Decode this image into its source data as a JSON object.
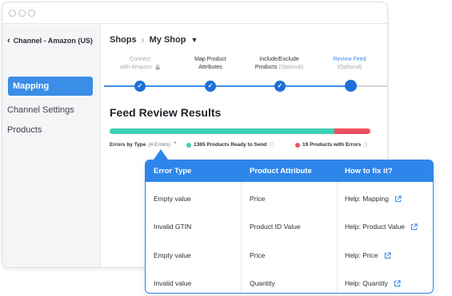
{
  "sidebar": {
    "back_label": "Channel - Amazon (US)",
    "items": [
      {
        "label": "Mapping",
        "active": true
      },
      {
        "label": "Channel Settings",
        "active": false
      },
      {
        "label": "Products",
        "active": false
      }
    ]
  },
  "breadcrumb": {
    "root": "Shops",
    "current": "My Shop"
  },
  "steps": [
    {
      "line1": "Connect",
      "line2": "with Amazon",
      "state": "disabled"
    },
    {
      "line1": "Map Product",
      "line2": "Attributes",
      "state": "done"
    },
    {
      "line1": "Include/Exclude",
      "line2": "Products",
      "optional": "(Optional)",
      "state": "done"
    },
    {
      "line1": "Review Feed",
      "line2": "(Optional)",
      "state": "current"
    }
  ],
  "results": {
    "title": "Feed Review Results",
    "ready_fraction": 0.8626,
    "errors_by_type_label": "Errors by Type",
    "errors_by_type_count": "(4 Errors)",
    "ready_label": "1365 Products Ready to Send",
    "errors_label": "19 Products with Errors"
  },
  "colors": {
    "primary": "#2f86ea",
    "ready": "#3fd0b4",
    "error": "#f04f5f"
  },
  "table": {
    "headers": [
      "Error Type",
      "Product Attribute",
      "How to fix it?"
    ],
    "rows": [
      [
        "Empty value",
        "Price",
        "Help: Mapping"
      ],
      [
        "Invalid GTIN",
        "Product ID Value",
        "Help: Product Value"
      ],
      [
        "Empty value",
        "Price",
        "Help: Price"
      ],
      [
        "Invalid value",
        "Quantity",
        "Help: Quantity"
      ]
    ]
  }
}
